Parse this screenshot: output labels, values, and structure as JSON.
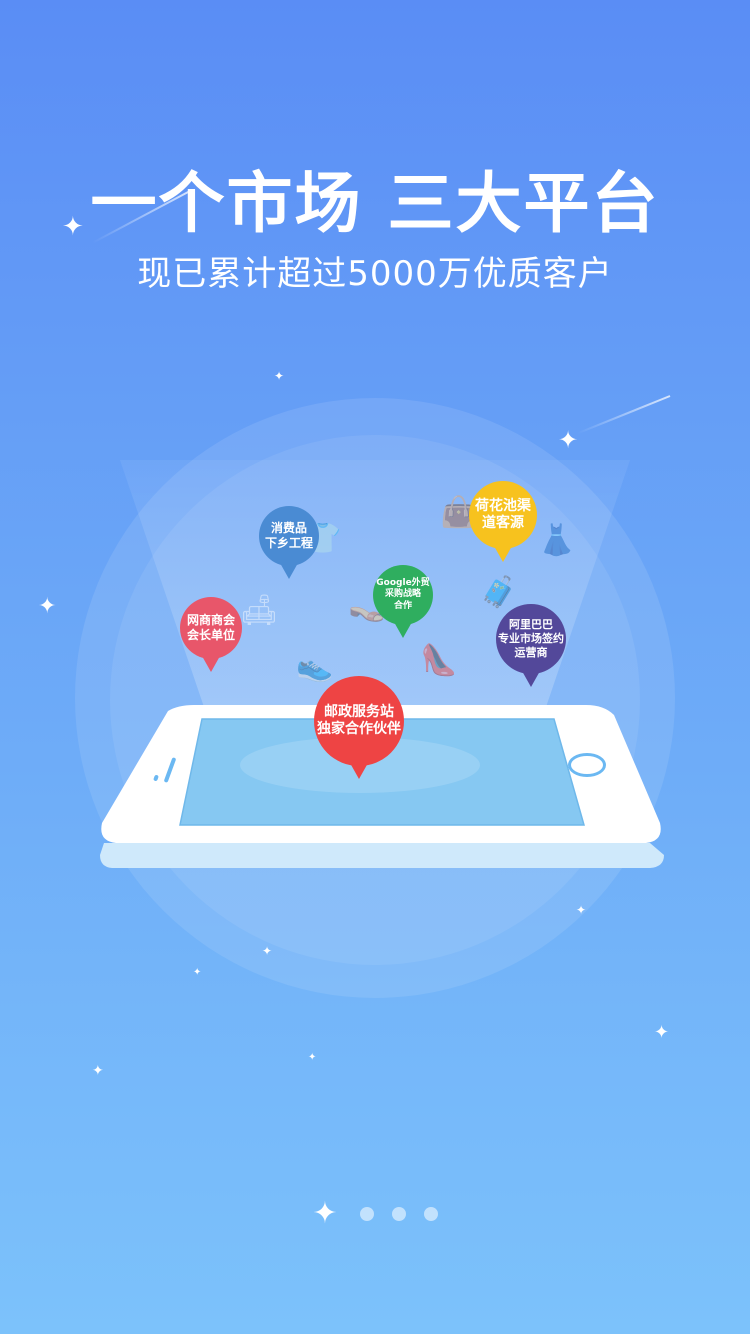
{
  "header": {
    "title": "一个市场 三大平台",
    "subtitle": "现已累计超过5000万优质客户"
  },
  "pins": [
    {
      "id": "pin-consumer",
      "lines": [
        "消费品",
        "下乡工程"
      ],
      "color": "#4a8bd3"
    },
    {
      "id": "pin-lotus",
      "lines": [
        "荷花池渠",
        "道客源"
      ],
      "color": "#f7c21e"
    },
    {
      "id": "pin-google",
      "lines": [
        "Google外贸",
        "采购战略",
        "合作"
      ],
      "color": "#2fae5f"
    },
    {
      "id": "pin-chamber",
      "lines": [
        "网商商会",
        "会长单位"
      ],
      "color": "#e8566a"
    },
    {
      "id": "pin-alibaba",
      "lines": [
        "阿里巴巴",
        "专业市场签约",
        "运营商"
      ],
      "color": "#53489a"
    },
    {
      "id": "pin-post",
      "lines": [
        "邮政服务站",
        "独家合作伙伴"
      ],
      "color": "#ee4444"
    }
  ],
  "pager": {
    "total": 4,
    "active": 0
  },
  "icons": [
    "star-icon",
    "shirt-icon",
    "sofa-icon",
    "slippers-icon",
    "suitcase-icon",
    "high-heel-icon",
    "dress-icon",
    "handbag-icon",
    "sneaker-icon"
  ]
}
